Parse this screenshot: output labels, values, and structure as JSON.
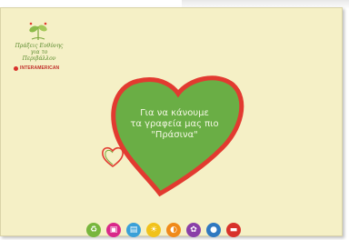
{
  "logo": {
    "title_lines": [
      "Πράξεις Ευθύνης",
      "για το Περιβάλλον"
    ],
    "brand": "INTERAMERICAN"
  },
  "heart": {
    "lines": [
      "Για να κάνουμε",
      "τα γραφεία μας πιο",
      "\"Πράσινα\""
    ],
    "fill_color": "#6aae45",
    "outline_color": "#e23a30"
  },
  "icons": [
    {
      "name": "recycle-icon",
      "color": "#78b63d",
      "glyph": "♻"
    },
    {
      "name": "printer-icon",
      "color": "#d9288a",
      "glyph": "▣"
    },
    {
      "name": "paper-icon",
      "color": "#3aa0d8",
      "glyph": "▤"
    },
    {
      "name": "lamp-icon",
      "color": "#f1c21b",
      "glyph": "☀"
    },
    {
      "name": "bulb-icon",
      "color": "#f08a1a",
      "glyph": "◐"
    },
    {
      "name": "flower-icon",
      "color": "#8a3fa8",
      "glyph": "✿"
    },
    {
      "name": "water-drop-icon",
      "color": "#2f78c0",
      "glyph": "●"
    },
    {
      "name": "car-icon",
      "color": "#d8322b",
      "glyph": "▬"
    }
  ]
}
